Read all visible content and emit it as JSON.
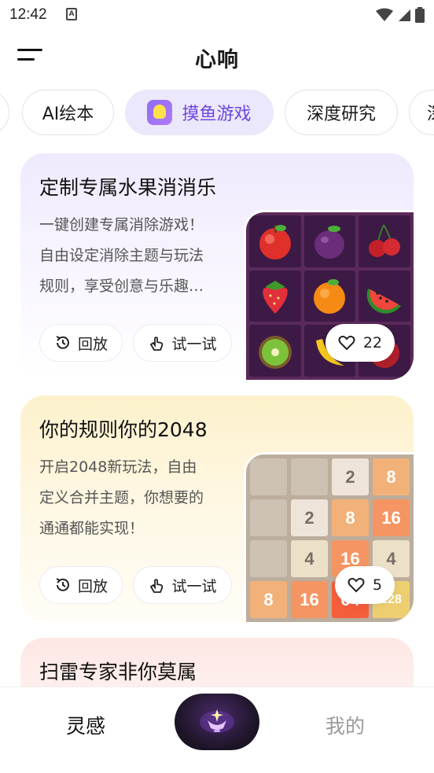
{
  "status_bar": {
    "time": "12:42",
    "notification_icon": "A"
  },
  "header": {
    "title": "心响",
    "menu_icon": "menu-icon"
  },
  "categories": [
    {
      "label": ""
    },
    {
      "label": "AI绘本"
    },
    {
      "label": "摸鱼游戏",
      "active": true
    },
    {
      "label": "深度研究"
    },
    {
      "label": "深"
    }
  ],
  "cards": [
    {
      "title": "定制专属水果消消乐",
      "description_lines": [
        "一键创建专属消除游戏！",
        "自由设定消除主题与玩法",
        "规则，享受创意与乐趣…"
      ],
      "replay_label": "回放",
      "try_label": "试一试",
      "likes": "22"
    },
    {
      "title": "你的规则你的2048",
      "description_lines": [
        "开启2048新玩法，自由",
        "定义合并主题，你想要的",
        "通通都能实现！"
      ],
      "replay_label": "回放",
      "try_label": "试一试",
      "likes": "5",
      "tiles": [
        "",
        "",
        "2",
        "8",
        "",
        "2",
        "8",
        "16",
        "",
        "4",
        "16",
        "4",
        "8",
        "16",
        "64",
        "128"
      ]
    },
    {
      "title": "扫雷专家非你莫属"
    }
  ],
  "bottom_nav": {
    "inspire_label": "灵感",
    "mine_label": "我的"
  },
  "colors": {
    "accent": "#6a46e0",
    "active_chip_bg": "#ece8fb"
  }
}
